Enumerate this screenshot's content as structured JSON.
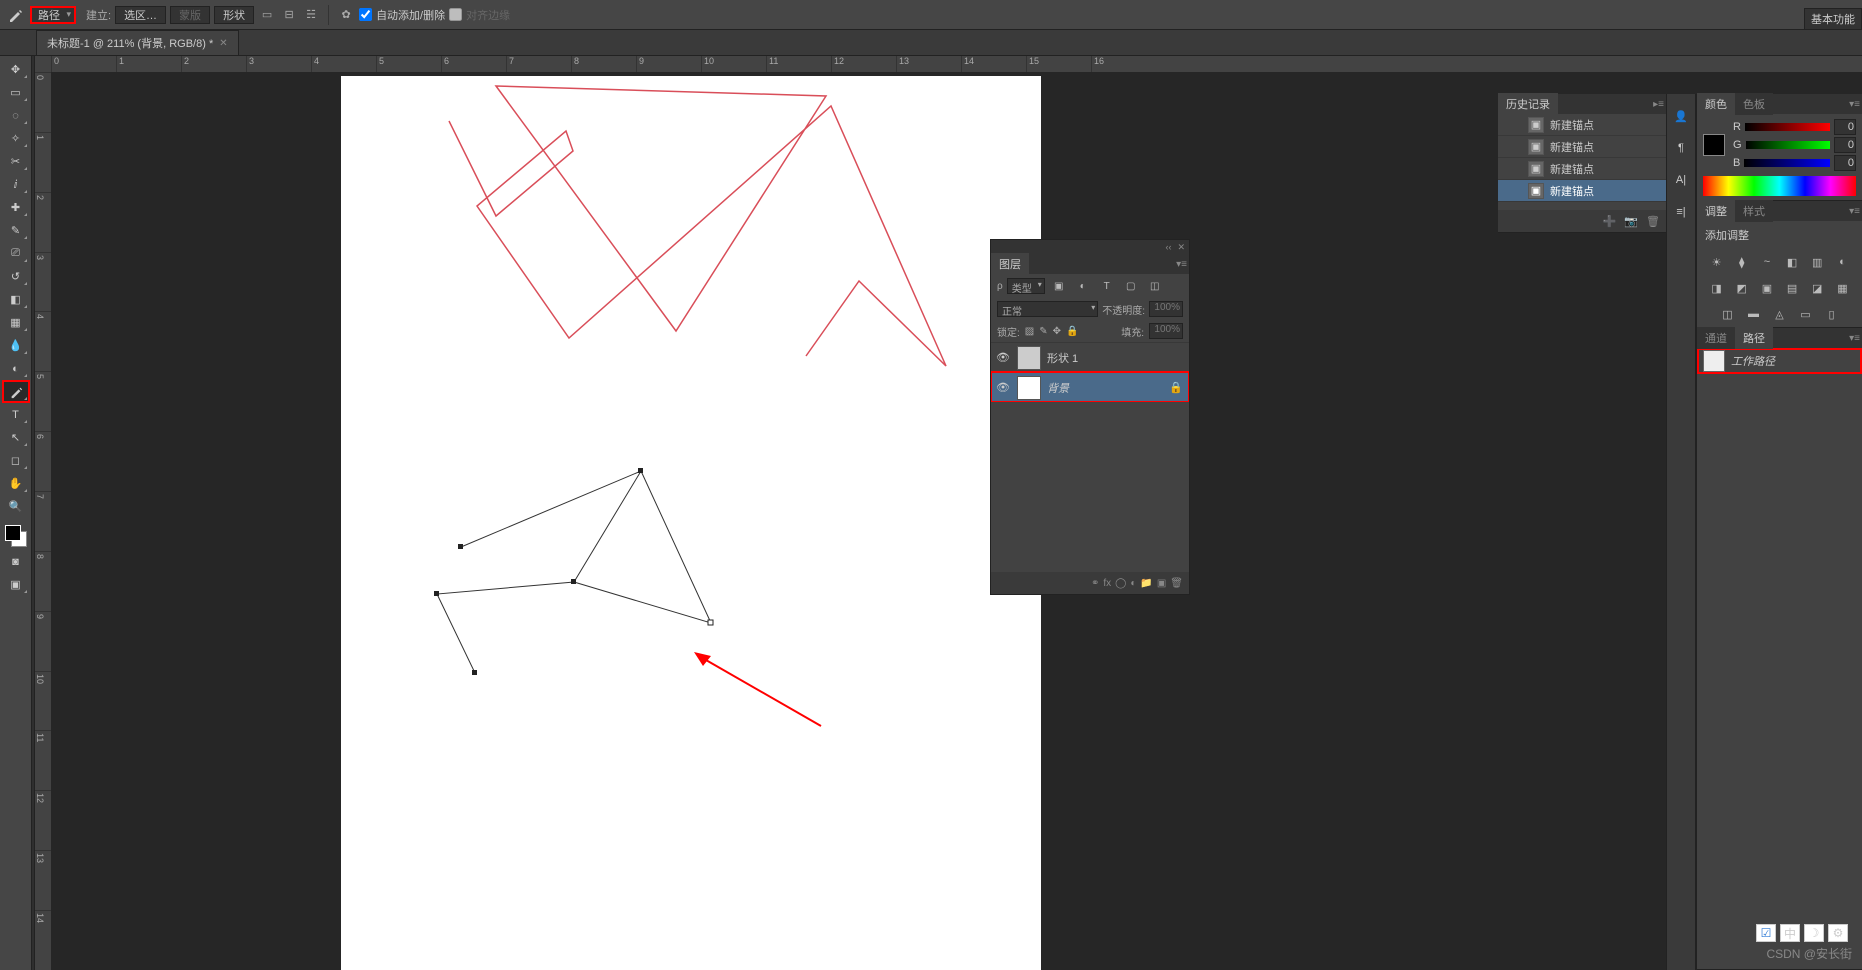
{
  "options": {
    "pickMode": "路径",
    "buildLabel": "建立:",
    "selectionBtn": "选区…",
    "maskBtn": "蒙版",
    "shapeBtn": "形状",
    "autoAdd": "自动添加/删除",
    "alignEdges": "对齐边缘",
    "basicFn": "基本功能"
  },
  "tab": {
    "title": "未标题-1 @ 211% (背景, RGB/8) *"
  },
  "rulerH": [
    "0",
    "1",
    "2",
    "3",
    "4",
    "5",
    "6",
    "7",
    "8",
    "9",
    "10",
    "11",
    "12",
    "13",
    "14",
    "15",
    "16"
  ],
  "rulerV": [
    "0",
    "1",
    "2",
    "3",
    "4",
    "5",
    "6",
    "7",
    "8",
    "9",
    "10",
    "11",
    "12",
    "13",
    "14"
  ],
  "history": {
    "title": "历史记录",
    "items": [
      "新建锚点",
      "新建锚点",
      "新建锚点",
      "新建锚点"
    ],
    "selected": 3
  },
  "colorPanel": {
    "tab1": "颜色",
    "tab2": "色板",
    "r": 0,
    "g": 0,
    "b": 0
  },
  "adjustments": {
    "tab1": "调整",
    "tab2": "样式",
    "addLabel": "添加调整"
  },
  "pathsPanel": {
    "tab1": "通道",
    "tab2": "路径",
    "workPath": "工作路径"
  },
  "layers": {
    "tab": "图层",
    "kindLabel": "类型",
    "blend": "正常",
    "opacityLabel": "不透明度:",
    "opacityVal": "100%",
    "lockLabel": "锁定:",
    "fillLabel": "填充:",
    "fillVal": "100%",
    "items": [
      {
        "name": "形状 1",
        "selected": false,
        "locked": false,
        "shape": true
      },
      {
        "name": "背景",
        "selected": true,
        "locked": true,
        "shape": false
      }
    ]
  },
  "watermark": "CSDN @安长街"
}
